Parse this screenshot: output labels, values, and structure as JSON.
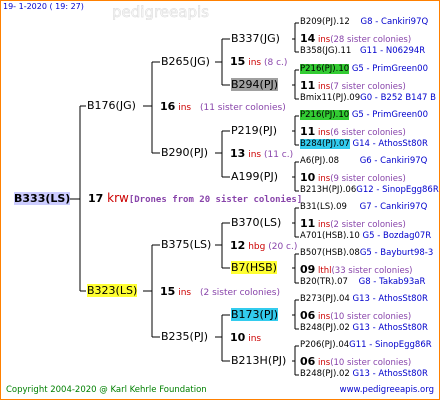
{
  "header": "19-   1-2020  ( 19:  27)",
  "colors": {
    "line": "#000000",
    "frame": "#ff8000",
    "blue": "#0000cc",
    "red": "#cc0000",
    "purple": "#8844aa"
  },
  "root": {
    "name": "B333(LS)",
    "num": "17",
    "ins": "krw",
    "note": "[Drones from 20 sister colonies]"
  },
  "g1": [
    {
      "name": "B176(JG)",
      "num": "16",
      "ins": "ins",
      "note": "(11 sister colonies)"
    },
    {
      "name": "B323(LS)",
      "num": "15",
      "ins": "ins",
      "note": "(2 sister colonies)"
    }
  ],
  "g2": [
    {
      "name": "B265(JG)",
      "num": "15",
      "ins": "ins",
      "note": "(8 c.)"
    },
    {
      "name": "B290(PJ)",
      "num": "13",
      "ins": "ins",
      "note": "(11 c.)"
    },
    {
      "name": "B375(LS)",
      "num": "12",
      "ins": "hbg",
      "note": "(20 c.)"
    },
    {
      "name": "B235(PJ)",
      "num": "10",
      "ins": "ins",
      "note": ""
    }
  ],
  "g3": [
    {
      "name": "B337(JG)",
      "num": "14",
      "ins": "ins",
      "note": "(28 sister colonies)"
    },
    {
      "name": "B294(PJ)",
      "num": "11",
      "ins": "ins",
      "note": "(7 sister colonies)"
    },
    {
      "name": "P219(PJ)",
      "num": "11",
      "ins": "ins",
      "note": "(6 sister colonies)"
    },
    {
      "name": "A199(PJ)",
      "num": "10",
      "ins": "ins",
      "note": "(9 sister colonies)"
    },
    {
      "name": "B370(LS)",
      "num": "11",
      "ins": "ins",
      "note": "(2 sister colonies)"
    },
    {
      "name": "B7(HSB)",
      "num": "09",
      "ins": "lthl",
      "note": "(33 sister colonies)"
    },
    {
      "name": "B173(PJ)",
      "num": "06",
      "ins": "ins",
      "note": "(10 sister colonies)"
    },
    {
      "name": "B213H(PJ)",
      "num": "06",
      "ins": "ins",
      "note": "(10 sister colonies)"
    }
  ],
  "g4": [
    [
      "B209(PJ).12",
      "G8 - Cankiri97Q"
    ],
    [
      "B358(JG).11",
      "G11 - N06294R"
    ],
    [
      "P216(PJ).10",
      "G5 - PrimGreen00"
    ],
    [
      "Bmix11(PJ).09",
      "G0 - B252 B147 B"
    ],
    [
      "P216(PJ).10",
      "G5 - PrimGreen00"
    ],
    [
      "B284(PJ).07",
      "G14 - AthosSt80R"
    ],
    [
      "A6(PJ).08",
      "G6 - Cankiri97Q"
    ],
    [
      "B213H(PJ).06",
      "G12 - SinopEgg86R"
    ],
    [
      "B31(LS).09",
      "G7 - Cankiri97Q"
    ],
    [
      "A701(HSB).10",
      "G5 - Bozdag07R"
    ],
    [
      "B507(HSB).08",
      "G5 - Bayburt98-3"
    ],
    [
      "B20(TR).07",
      "G8 - Takab93aR"
    ],
    [
      "B273(PJ).04",
      "G13 - AthosSt80R"
    ],
    [
      "B248(PJ).02",
      "G13 - AthosSt80R"
    ],
    [
      "P206(PJ).04",
      "G11 - SinopEgg86R"
    ],
    [
      "B248(PJ).02",
      "G13 - AthosSt80R"
    ]
  ],
  "footer": {
    "copyright": "Copyright 2004-2020 @ Karl Kehrle Foundation",
    "url": "www.pedigreeapis.org"
  }
}
